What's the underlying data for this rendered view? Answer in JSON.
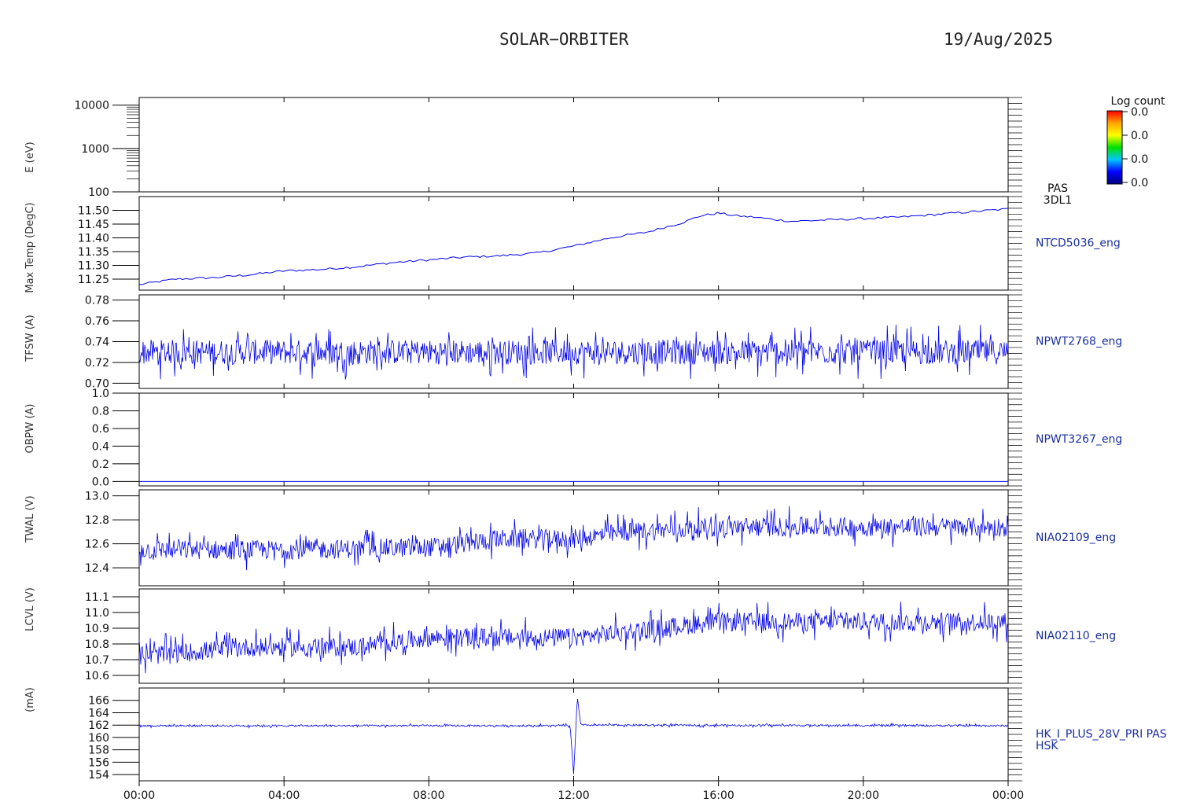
{
  "header": {
    "title": "SOLAR−ORBITER",
    "date": "19/Aug/2025"
  },
  "colorbar": {
    "title": "Log count",
    "ticks": [
      "0.0",
      "0.0",
      "0.0",
      "0.0"
    ],
    "colors": [
      "#ff0000",
      "#ffa500",
      "#ffff00",
      "#00e000",
      "#00c8ff",
      "#0000ff",
      "#000080"
    ]
  },
  "y_axis_labels": [
    "E (eV)",
    "Max Temp (DegC)",
    "TFSW (A)",
    "OBPW (A)",
    "TWAL (V)",
    "LCVL (V)",
    "(mA)"
  ],
  "chart_data": [
    {
      "type": "heatmap",
      "label": "PAS\n3DL1",
      "ylabel": "E (eV)",
      "log_y": true,
      "ylim": [
        100,
        15000
      ],
      "ticks": [
        100,
        1000,
        10000
      ],
      "tick_labels": [
        "100",
        "1000",
        "10000"
      ],
      "values": []
    },
    {
      "type": "line",
      "label": "NTCD5036_eng",
      "ylim": [
        11.21,
        11.55
      ],
      "ticks": [
        11.25,
        11.3,
        11.35,
        11.4,
        11.45,
        11.5
      ],
      "tick_labels": [
        "11.25",
        "11.30",
        "11.35",
        "11.40",
        "11.45",
        "11.50"
      ],
      "x": [
        0,
        1,
        2,
        3,
        4,
        5,
        6,
        7,
        8,
        9,
        10,
        11,
        12,
        13,
        14,
        15,
        15.5,
        16,
        16.5,
        17,
        18,
        19,
        20,
        21,
        22,
        23,
        24
      ],
      "values": [
        11.23,
        11.25,
        11.255,
        11.265,
        11.28,
        11.285,
        11.295,
        11.31,
        11.32,
        11.33,
        11.335,
        11.345,
        11.37,
        11.4,
        11.42,
        11.455,
        11.48,
        11.49,
        11.48,
        11.475,
        11.46,
        11.465,
        11.47,
        11.475,
        11.485,
        11.495,
        11.505
      ]
    },
    {
      "type": "line",
      "label": "NPWT2768_eng",
      "ylim": [
        0.695,
        0.785
      ],
      "ticks": [
        0.7,
        0.72,
        0.74,
        0.76,
        0.78
      ],
      "tick_labels": [
        "0.70",
        "0.72",
        "0.74",
        "0.76",
        "0.78"
      ],
      "x": [
        0,
        24
      ],
      "values": [
        0.73,
        0.73
      ],
      "noise": 0.012
    },
    {
      "type": "line",
      "label": "NPWT3267_eng",
      "ylim": [
        -0.05,
        1.0
      ],
      "ticks": [
        0.0,
        0.2,
        0.4,
        0.6,
        0.8,
        1.0
      ],
      "tick_labels": [
        "0.0",
        "0.2",
        "0.4",
        "0.6",
        "0.8",
        "1.0"
      ],
      "x": [
        0,
        24
      ],
      "values": [
        0.0,
        0.0
      ]
    },
    {
      "type": "line",
      "label": "NIA02109_eng",
      "ylim": [
        12.25,
        13.05
      ],
      "ticks": [
        12.4,
        12.6,
        12.8,
        13.0
      ],
      "tick_labels": [
        "12.4",
        "12.6",
        "12.8",
        "13.0"
      ],
      "x": [
        0,
        4,
        8,
        10,
        12,
        13.5,
        16,
        20,
        24
      ],
      "values": [
        12.55,
        12.55,
        12.57,
        12.64,
        12.64,
        12.7,
        12.74,
        12.74,
        12.74
      ],
      "noise": 0.08
    },
    {
      "type": "line",
      "label": "NIA02110_eng",
      "ylim": [
        10.55,
        11.15
      ],
      "ticks": [
        10.6,
        10.7,
        10.8,
        10.9,
        11.0,
        11.1
      ],
      "tick_labels": [
        "10.6",
        "10.7",
        "10.8",
        "10.9",
        "11.0",
        "11.1"
      ],
      "x": [
        0,
        3,
        6,
        8,
        12,
        13.5,
        16,
        20,
        24
      ],
      "values": [
        10.72,
        10.78,
        10.78,
        10.84,
        10.84,
        10.88,
        10.94,
        10.94,
        10.94
      ],
      "noise": 0.06
    },
    {
      "type": "line",
      "label": "HK_I_PLUS_28V_PRI PAS\nHSK",
      "ylim": [
        153,
        168
      ],
      "ticks": [
        154,
        156,
        158,
        160,
        162,
        164,
        166
      ],
      "tick_labels": [
        "154",
        "156",
        "158",
        "160",
        "162",
        "164",
        "166"
      ],
      "x": [
        0,
        11.9,
        12.0,
        12.05,
        12.1,
        12.2,
        24
      ],
      "values": [
        161.9,
        161.9,
        154.2,
        160,
        166.5,
        162,
        161.9
      ],
      "noise": 0.15
    }
  ],
  "x_axis": {
    "range": [
      0,
      24
    ],
    "ticks": [
      0,
      4,
      8,
      12,
      16,
      20,
      24
    ],
    "tick_labels": [
      "00:00",
      "04:00",
      "08:00",
      "12:00",
      "16:00",
      "20:00",
      "00:00"
    ]
  },
  "colors": {
    "series": "#0000ee",
    "axis": "#000000",
    "label": "#1a2fa0"
  }
}
